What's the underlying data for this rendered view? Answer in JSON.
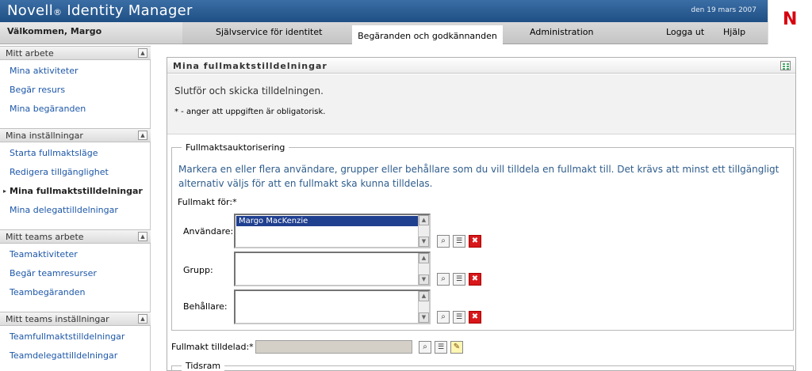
{
  "header": {
    "app_title": "Novell",
    "app_title_reg": "®",
    "app_title_rest": " Identity Manager",
    "date": "den 19 mars 2007",
    "welcome": "Välkommen, Margo",
    "logo_letter": "N"
  },
  "tabs": {
    "self_service": "Självservice för identitet",
    "requests": "Begäranden och godkännanden",
    "administration": "Administration",
    "logout": "Logga ut",
    "help": "Hjälp"
  },
  "sidebar": {
    "sections": [
      {
        "title": "Mitt arbete",
        "items": [
          "Mina aktiviteter",
          "Begär resurs",
          "Mina begäranden"
        ]
      },
      {
        "title": "Mina inställningar",
        "items": [
          "Starta fullmaktsläge",
          "Redigera tillgänglighet",
          "Mina fullmaktstilldelningar",
          "Mina delegattilldelningar"
        ]
      },
      {
        "title": "Mitt teams arbete",
        "items": [
          "Teamaktiviteter",
          "Begär teamresurser",
          "Teambegäranden"
        ]
      },
      {
        "title": "Mitt teams inställningar",
        "items": [
          "Teamfullmaktstilldelningar",
          "Teamdelegattilldelningar"
        ]
      }
    ],
    "active_item": "Mina fullmaktstilldelningar"
  },
  "panel": {
    "title": "Mina fullmaktstilldelningar",
    "intro": "Slutför och skicka tilldelningen.",
    "required_note": "* - anger att uppgiften är obligatorisk.",
    "authorization": {
      "legend": "Fullmaktsauktorisering",
      "description": "Markera en eller flera användare, grupper eller behållare som du vill tilldela en fullmakt till. Det krävs att minst ett tillgängligt alternativ väljs för att en fullmakt ska kunna tilldelas.",
      "proxy_for_label": "Fullmakt för:*",
      "users_label": "Användare:",
      "users_selected": "Margo MacKenzie",
      "group_label": "Grupp:",
      "container_label": "Behållare:"
    },
    "assigned_label": "Fullmakt tilldelad:*",
    "assigned_value": "",
    "timeframe_legend": "Tidsram"
  }
}
